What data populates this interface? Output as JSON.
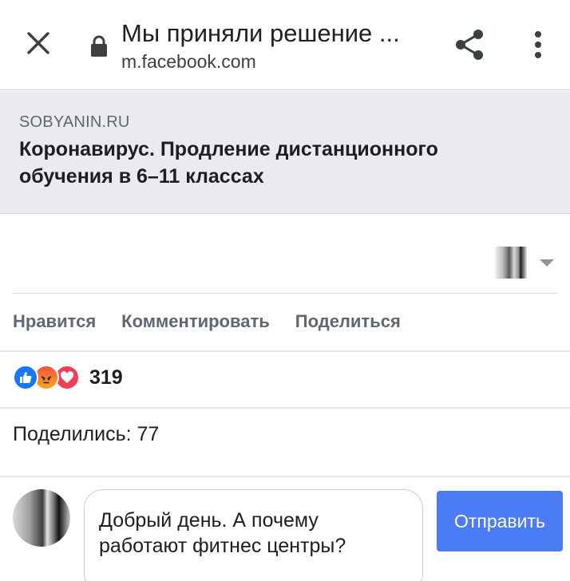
{
  "browser": {
    "title": "Мы приняли решение ...",
    "url": "m.facebook.com",
    "icons": {
      "close": "close-icon",
      "lock": "lock-icon",
      "share": "share-icon",
      "menu": "more-vert-icon"
    }
  },
  "preview": {
    "source": "SOBYANIN.RU",
    "title": "Коронавирус. Продление дистанционного обучения в 6–11 классах"
  },
  "actions": {
    "like": "Нравится",
    "comment": "Комментировать",
    "share": "Поделиться"
  },
  "reactions": {
    "icons": [
      "like-reaction-icon",
      "angry-reaction-icon",
      "love-reaction-icon"
    ],
    "count": "319"
  },
  "shares": {
    "text": "Поделились: 77"
  },
  "composer": {
    "text": "Добрый день. А почему работают фитнес центры?",
    "send_label": "Отправить"
  },
  "colors": {
    "send_button": "#4a7cf6",
    "like": "#1877f2",
    "love": "#f33e58",
    "preview_bg": "#e9ebee"
  }
}
